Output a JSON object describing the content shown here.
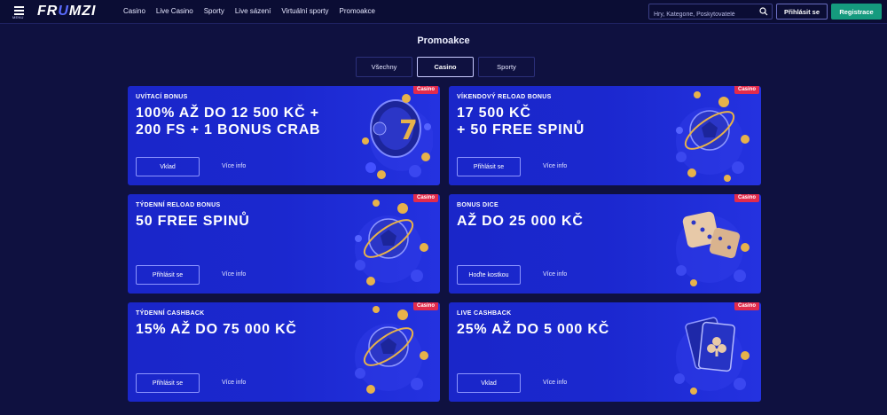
{
  "header": {
    "menu_label": "MENU",
    "logo_prefix": "FR",
    "logo_accent": "U",
    "logo_suffix": "MZI",
    "nav": [
      "Casino",
      "Live Casino",
      "Sporty",
      "Live sázení",
      "Virtuální sporty",
      "Promoakce"
    ],
    "search_placeholder": "Hry, Kategorie, Poskytovatelé",
    "login_label": "Přihlásit se",
    "register_label": "Registrace"
  },
  "page": {
    "title": "Promoakce"
  },
  "tabs": [
    {
      "label": "Všechny",
      "active": false
    },
    {
      "label": "Casino",
      "active": true
    },
    {
      "label": "Sporty",
      "active": false
    }
  ],
  "cards": [
    {
      "badge": "Casino",
      "subtitle": "UVÍTACÍ BONUS",
      "headline_1": "100% AŽ DO 12 500 KČ +",
      "headline_2": "200 FS + 1 BONUS CRAB",
      "cta": "Vklad",
      "more": "Více info",
      "art": "slot-reel-icon"
    },
    {
      "badge": "Casino",
      "subtitle": "VÍKENDOVÝ RELOAD BONUS",
      "headline_1": "17 500 KČ",
      "headline_2": "+ 50 FREE SPINŮ",
      "cta": "Přihlásit se",
      "more": "Více info",
      "art": "soccer-ball-icon"
    },
    {
      "badge": "Casino",
      "subtitle": "TÝDENNÍ RELOAD BONUS",
      "headline_1": "50 FREE SPINŮ",
      "headline_2": "",
      "cta": "Přihlásit se",
      "more": "Více info",
      "art": "soccer-ball-icon"
    },
    {
      "badge": "Casino",
      "subtitle": "BONUS DICE",
      "headline_1": "AŽ DO 25 000 KČ",
      "headline_2": "",
      "cta": "Hoďte kostkou",
      "more": "Více info",
      "art": "dice-icon"
    },
    {
      "badge": "Casino",
      "subtitle": "TÝDENNÍ CASHBACK",
      "headline_1": "15% AŽ DO 75 000 KČ",
      "headline_2": "",
      "cta": "Přihlásit se",
      "more": "Více info",
      "art": "soccer-ball-icon"
    },
    {
      "badge": "Casino",
      "subtitle": "LIVE CASHBACK",
      "headline_1": "25% AŽ DO 5 000 KČ",
      "headline_2": "",
      "cta": "Vklad",
      "more": "Více info",
      "art": "playing-cards-icon"
    }
  ],
  "colors": {
    "bg": "#0f1140",
    "card": "#1b28cf",
    "badge": "#e22b4c",
    "register": "#159a7e",
    "gold": "#e7b24a"
  }
}
